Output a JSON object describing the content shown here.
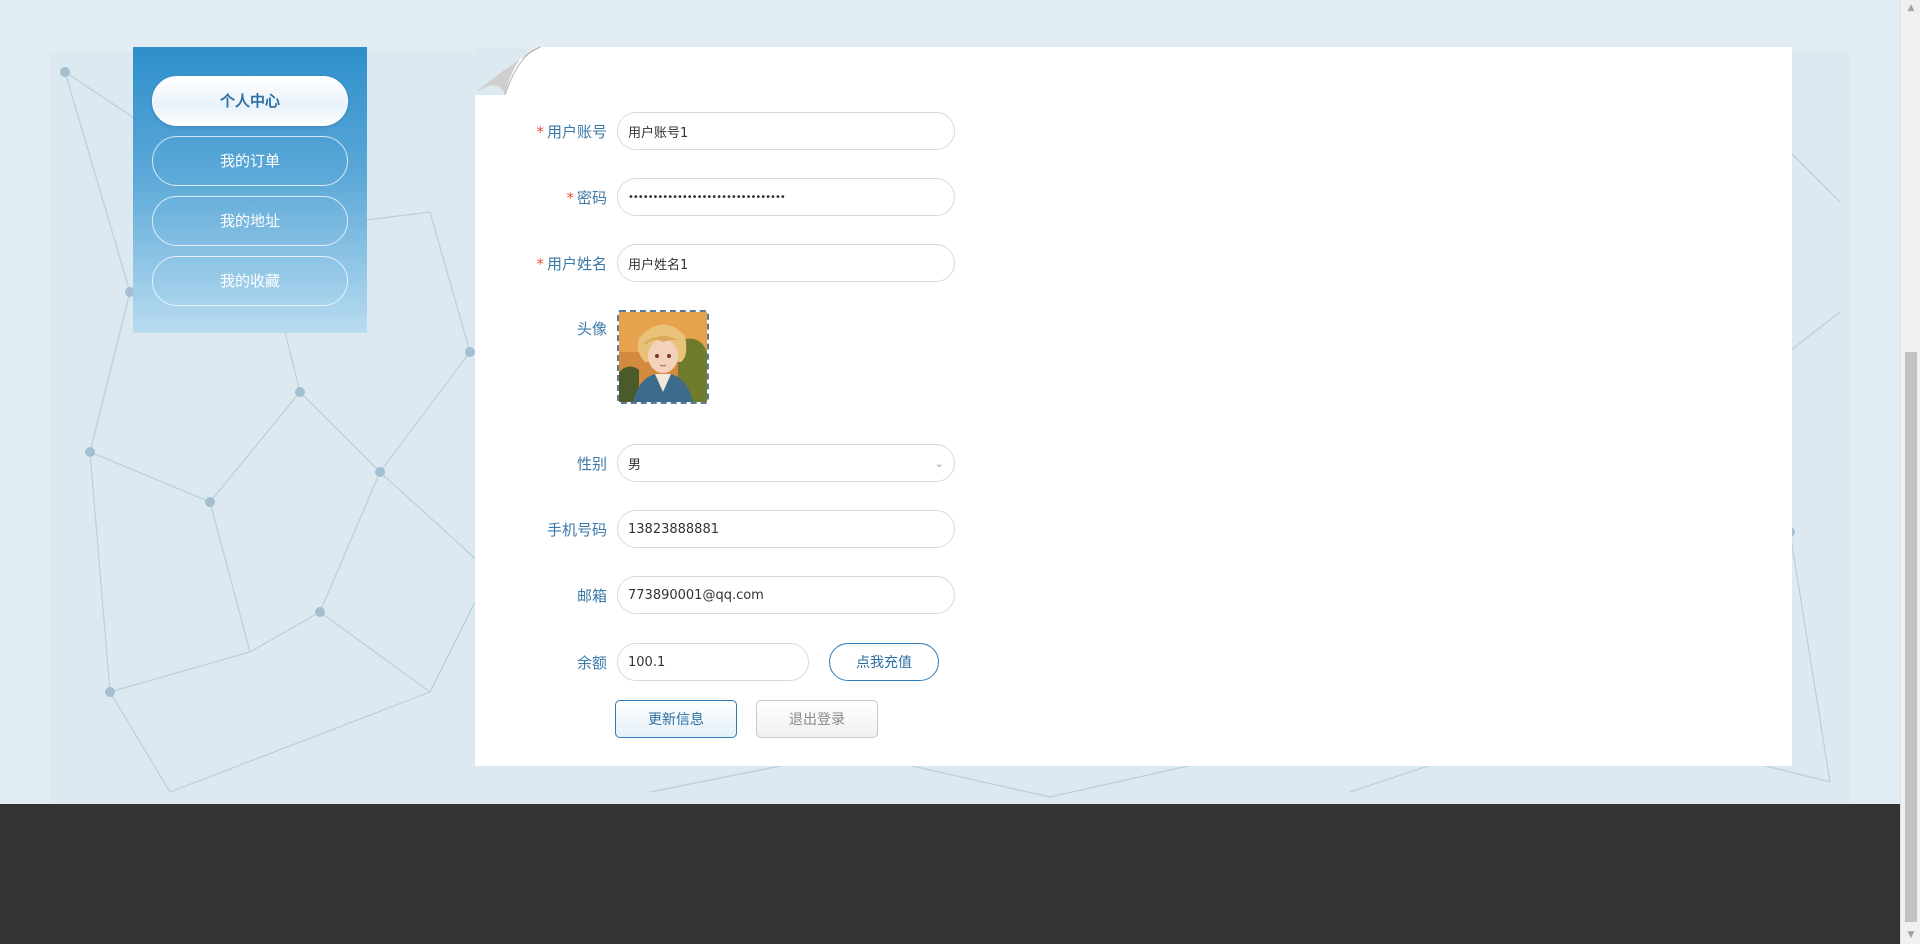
{
  "sidebar": {
    "items": [
      {
        "label": "个人中心",
        "active": true
      },
      {
        "label": "我的订单",
        "active": false
      },
      {
        "label": "我的地址",
        "active": false
      },
      {
        "label": "我的收藏",
        "active": false
      }
    ]
  },
  "form": {
    "required_mark": "*",
    "username": {
      "label": "用户账号",
      "value": "用户账号1"
    },
    "password": {
      "label": "密码",
      "value": "••••••••••••••••••••••••••••••••"
    },
    "realname": {
      "label": "用户姓名",
      "value": "用户姓名1"
    },
    "avatar": {
      "label": "头像"
    },
    "gender": {
      "label": "性别",
      "value": "男"
    },
    "phone": {
      "label": "手机号码",
      "value": "13823888881"
    },
    "email": {
      "label": "邮箱",
      "value": "773890001@qq.com"
    },
    "balance": {
      "label": "余额",
      "value": "100.1"
    },
    "recharge_label": "点我充值",
    "update_label": "更新信息",
    "logout_label": "退出登录"
  },
  "colors": {
    "accent": "#2e7bb8",
    "label": "#3a78a8",
    "required": "#e6543d",
    "footer": "#333333"
  }
}
